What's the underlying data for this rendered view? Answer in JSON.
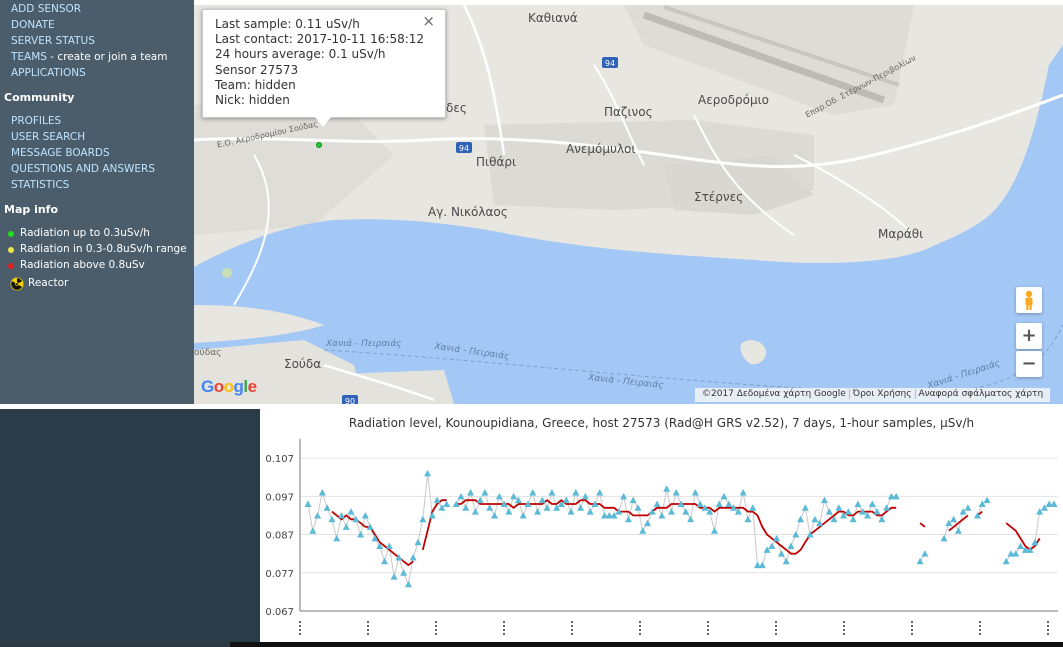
{
  "sidebar": {
    "links_top": [
      "ADD SENSOR",
      "DONATE",
      "SERVER STATUS"
    ],
    "teams_label": "TEAMS",
    "teams_tail": " - create or join a team",
    "applications": "APPLICATIONS",
    "community_heading": "Community",
    "community_links": [
      "PROFILES",
      "USER SEARCH",
      "MESSAGE BOARDS",
      "QUESTIONS AND ANSWERS",
      "STATISTICS"
    ],
    "mapinfo_heading": "Map info",
    "legend": [
      {
        "text": "Radiation up to 0.3uSv/h",
        "color": "#22dd22"
      },
      {
        "text": "Radiation in 0.3-0.8uSv/h range",
        "color": "#e8e84a"
      },
      {
        "text": "Radiation above 0.8uSv",
        "color": "#e02020"
      }
    ],
    "reactor_label": "Reactor"
  },
  "popup": {
    "lines": [
      "Last sample: 0.11 uSv/h",
      "Last contact: 2017-10-11 16:58:12",
      "24 hours average: 0.1 uSv/h",
      "Sensor 27573",
      "Team: hidden",
      "Nick: hidden"
    ],
    "close_symbol": "×"
  },
  "map": {
    "places": [
      "Καθιανά",
      "Αεροδρόμιο",
      "Παζινος",
      "Ανεμόμυλοι",
      "Πιθάρι",
      "Στέρνες",
      "Αγ. Νικόλαος",
      "Μαράθι",
      "Σούδα",
      "δες",
      "ούδας"
    ],
    "road_numbers": [
      "94",
      "94",
      "90"
    ],
    "road_names": [
      "Ε.Ο. Αεροδρομίου Σούδας",
      "Επαρ.Οδ. Στέρνων-Περιβολίων"
    ],
    "ferry_labels": [
      "Χανιά - Πειραιάς",
      "Χανιά - Πειραιάς",
      "Χανιά - Πειραιάς",
      "Χανιά - Πειραιάς"
    ],
    "google_letters": [
      "G",
      "o",
      "o",
      "g",
      "l",
      "e"
    ],
    "google_colors": [
      "#4285f4",
      "#ea4335",
      "#fbbc05",
      "#4285f4",
      "#34a853",
      "#ea4335"
    ],
    "attribution": [
      "©2017 Δεδομένα χάρτη Google",
      "Όροι Χρήσης",
      "Αναφορά σφάλματος χάρτη"
    ],
    "zoom_in": "+",
    "zoom_out": "−"
  },
  "chart_data": {
    "type": "line",
    "title": "Radiation level, Kounoupidiana, Greece,  host 27573 (Rad@H GRS v2.52), 7 days, 1-hour samples, µSv/h",
    "ylim": [
      0.067,
      0.112
    ],
    "yticks": [
      "0.107",
      "0.097",
      "0.087",
      "0.077",
      "0.067"
    ],
    "ytick_values": [
      0.107,
      0.097,
      0.087,
      0.077,
      0.067
    ],
    "x_tick_marks": 12,
    "grid": true,
    "series": [
      {
        "kind": "samples",
        "color": "#5bbad6",
        "values": [
          0.095,
          0.088,
          0.092,
          0.098,
          0.094,
          0.091,
          0.086,
          0.092,
          0.089,
          0.093,
          0.091,
          0.087,
          0.092,
          0.089,
          0.086,
          0.084,
          0.08,
          0.084,
          0.076,
          0.081,
          0.077,
          0.074,
          0.081,
          0.085,
          0.091,
          0.103,
          0.092,
          0.096,
          0.094,
          0.095,
          null,
          0.095,
          0.097,
          0.094,
          0.098,
          0.093,
          0.096,
          0.098,
          0.094,
          0.092,
          0.097,
          0.095,
          0.093,
          0.097,
          0.096,
          0.092,
          0.095,
          0.098,
          0.093,
          0.096,
          0.094,
          0.098,
          0.094,
          0.095,
          0.096,
          0.093,
          0.098,
          0.094,
          0.097,
          0.093,
          0.095,
          0.098,
          0.092,
          0.092,
          0.092,
          0.093,
          0.097,
          0.091,
          0.096,
          0.094,
          0.088,
          0.09,
          0.093,
          0.095,
          0.092,
          0.099,
          0.093,
          0.098,
          0.095,
          0.093,
          0.091,
          0.098,
          0.095,
          0.094,
          0.093,
          0.088,
          0.095,
          0.097,
          0.095,
          0.094,
          0.093,
          0.098,
          0.091,
          0.094,
          0.079,
          0.079,
          0.083,
          0.084,
          0.086,
          0.082,
          0.08,
          0.084,
          0.087,
          0.091,
          0.094,
          0.087,
          0.091,
          0.09,
          0.096,
          0.093,
          0.091,
          0.094,
          0.092,
          0.093,
          0.091,
          0.095,
          0.093,
          0.092,
          0.095,
          0.093,
          0.091,
          0.094,
          0.097,
          0.097,
          null,
          null,
          null,
          null,
          0.08,
          0.082,
          null,
          null,
          null,
          0.086,
          0.09,
          0.091,
          0.088,
          0.093,
          0.094,
          null,
          0.092,
          0.095,
          0.096,
          null,
          null,
          null,
          0.08,
          0.082,
          0.082,
          0.084,
          0.083,
          0.083,
          0.085,
          0.093,
          0.094,
          0.095,
          0.095
        ],
        "name": ""
      },
      {
        "kind": "moving_average",
        "color": "#c00000",
        "values": [
          null,
          null,
          null,
          null,
          null,
          0.093,
          0.092,
          0.091,
          0.092,
          0.091,
          0.091,
          0.09,
          0.089,
          0.089,
          0.087,
          0.085,
          0.084,
          0.083,
          0.082,
          0.081,
          0.08,
          0.079,
          0.08,
          null,
          0.083,
          0.088,
          0.093,
          0.095,
          0.096,
          0.096,
          null,
          0.095,
          0.095,
          0.096,
          0.096,
          0.096,
          0.095,
          0.095,
          0.095,
          0.095,
          0.095,
          0.095,
          0.095,
          0.094,
          0.095,
          0.095,
          0.095,
          0.095,
          0.095,
          0.095,
          0.096,
          0.095,
          0.095,
          0.096,
          0.095,
          0.095,
          0.095,
          0.096,
          0.096,
          0.095,
          0.095,
          0.095,
          0.094,
          0.094,
          0.094,
          0.093,
          0.093,
          0.093,
          0.092,
          0.092,
          0.092,
          0.092,
          0.093,
          0.094,
          0.094,
          0.094,
          0.095,
          0.095,
          0.095,
          0.095,
          0.095,
          0.095,
          0.094,
          0.094,
          0.094,
          0.093,
          0.094,
          0.094,
          0.094,
          0.094,
          0.094,
          0.094,
          0.093,
          0.093,
          0.092,
          0.089,
          0.087,
          0.086,
          0.085,
          0.084,
          0.083,
          0.082,
          0.082,
          0.083,
          0.085,
          0.087,
          0.088,
          0.089,
          0.09,
          0.091,
          0.092,
          0.093,
          0.093,
          0.092,
          0.092,
          0.093,
          0.093,
          0.093,
          0.093,
          0.092,
          0.092,
          0.093,
          0.094,
          0.094,
          null,
          null,
          null,
          null,
          0.09,
          0.089,
          null,
          null,
          null,
          null,
          0.088,
          0.089,
          0.09,
          0.091,
          0.092,
          null,
          0.092,
          0.093,
          null,
          null,
          null,
          null,
          0.09,
          0.089,
          0.088,
          0.086,
          0.084,
          0.083,
          0.084,
          0.086,
          null,
          null,
          null,
          null
        ],
        "name": ""
      }
    ]
  }
}
